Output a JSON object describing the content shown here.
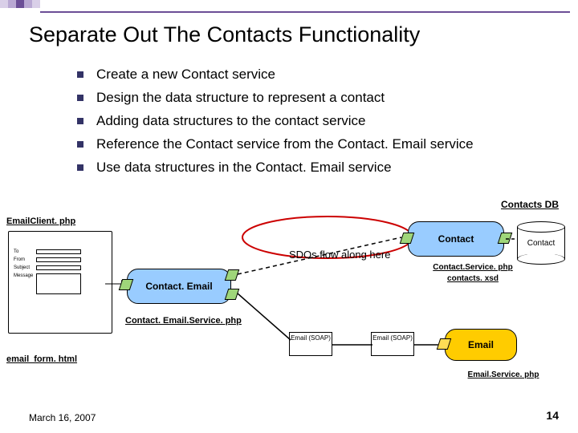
{
  "title": "Separate Out The Contacts Functionality",
  "bullets": [
    "Create a new Contact service",
    "Design the data structure to represent a contact",
    "Adding data structures to the contact service",
    "Reference the Contact service from the Contact. Email service",
    "Use data structures in the Contact. Email service"
  ],
  "labels": {
    "contacts_db": "Contacts DB",
    "email_client": "EmailClient. php",
    "email_form": "email_form. html",
    "contact_email": "Contact. Email",
    "contact_email_service": "Contact. Email.Service. php",
    "contact": "Contact",
    "contact_cyl": "Contact",
    "contact_service": "Contact.Service. php",
    "contacts_xsd": "contacts. xsd",
    "email": "Email",
    "email_soap": "Email (SOAP)",
    "email_service": "Email.Service. php",
    "sdo": "SDOs flow along here"
  },
  "form": {
    "to": "To",
    "from": "From",
    "subject": "Subject",
    "message": "Message"
  },
  "footer": {
    "date": "March 16, 2007",
    "page": "14"
  }
}
